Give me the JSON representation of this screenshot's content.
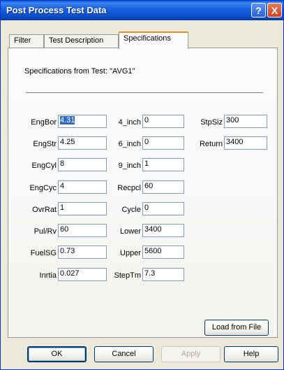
{
  "window": {
    "title": "Post Process Test Data",
    "help_glyph": "?",
    "close_glyph": "X"
  },
  "tabs": [
    {
      "label": "Filter",
      "active": false
    },
    {
      "label": "Test Description",
      "active": false
    },
    {
      "label": "Specifications",
      "active": true
    }
  ],
  "specs": {
    "heading": "Specifications from Test: \"AVG1\"",
    "col1": [
      {
        "label": "EngBor",
        "value": "4.31"
      },
      {
        "label": "EngStr",
        "value": "4.25"
      },
      {
        "label": "EngCyl",
        "value": "8"
      },
      {
        "label": "EngCyc",
        "value": "4"
      },
      {
        "label": "OvrRat",
        "value": "1"
      },
      {
        "label": "Pul/Rv",
        "value": "60"
      },
      {
        "label": "FuelSG",
        "value": "0.73"
      },
      {
        "label": "Inrtia",
        "value": "0.027"
      }
    ],
    "col2": [
      {
        "label": "4_inch",
        "value": "0"
      },
      {
        "label": "6_inch",
        "value": "0"
      },
      {
        "label": "9_inch",
        "value": "1"
      },
      {
        "label": "Recpcl",
        "value": "60"
      },
      {
        "label": "Cycle",
        "value": "0"
      },
      {
        "label": "Lower",
        "value": "3400"
      },
      {
        "label": "Upper",
        "value": "5600"
      },
      {
        "label": "StepTm",
        "value": "7.3"
      }
    ],
    "col3": [
      {
        "label": "StpSiz",
        "value": "300"
      },
      {
        "label": "Return",
        "value": "3400"
      }
    ]
  },
  "buttons": {
    "load": "Load from File",
    "ok": "OK",
    "cancel": "Cancel",
    "apply": "Apply",
    "help": "Help"
  }
}
